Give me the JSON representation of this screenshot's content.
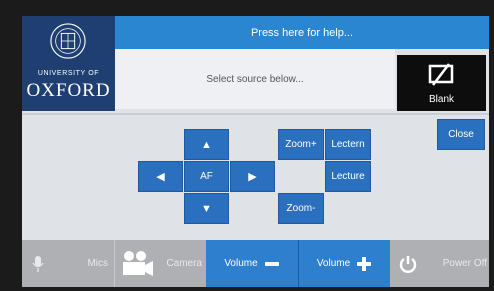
{
  "logo": {
    "line1": "UNIVERSITY OF",
    "line2": "OXFORD"
  },
  "header": {
    "help_text": "Press here for help..."
  },
  "source": {
    "prompt": "Select source below..."
  },
  "blank": {
    "label": "Blank"
  },
  "close": {
    "label": "Close"
  },
  "camera_pad": {
    "up": "▲",
    "down": "▼",
    "left": "◀",
    "right": "▶",
    "center": "AF"
  },
  "zoom": {
    "in": "Zoom+",
    "out": "Zoom-"
  },
  "presets": {
    "lectern": "Lectern",
    "lecture": "Lecture"
  },
  "bottom_bar": {
    "mics": "Mics",
    "camera": "Camera",
    "volume_down": "Volume",
    "volume_up": "Volume",
    "power_off": "Power Off"
  },
  "colors": {
    "brand": "#1f3f72",
    "accent": "#2b6fbf",
    "help_bar": "#2a86d1"
  }
}
